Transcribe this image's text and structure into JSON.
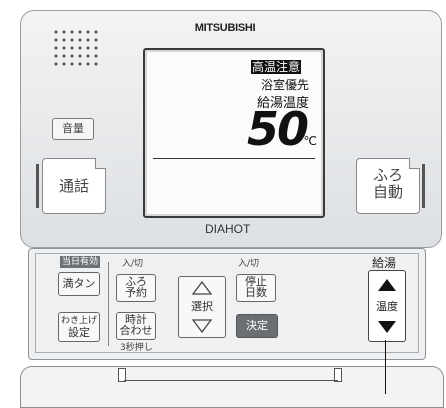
{
  "brand": "MITSUBISHI",
  "model": "DIAHOT",
  "lcd": {
    "warning": "高温注意",
    "priority": "浴室優先",
    "label": "給湯温度",
    "temperature": "50",
    "unit": "℃"
  },
  "upper_buttons": {
    "volume": "音量",
    "talk": "通話",
    "bath_auto_line1": "ふろ",
    "bath_auto_line2": "自動"
  },
  "lower_panel": {
    "current_effective": "当日有効",
    "full_tank": "満タン",
    "reheat_setting_line1": "わき上げ",
    "reheat_setting_line2": "設定",
    "on_off_1": "入/切",
    "bath_reserve_line1": "ふろ",
    "bath_reserve_line2": "予約",
    "clock_set_line1": "時計",
    "clock_set_line2": "合わせ",
    "hold3s": "3秒押し",
    "select": "選択",
    "on_off_2": "入/切",
    "stop_days_line1": "停止",
    "stop_days_line2": "日数",
    "confirm": "決定",
    "hot_water": "給湯",
    "temp_label": "温度"
  }
}
